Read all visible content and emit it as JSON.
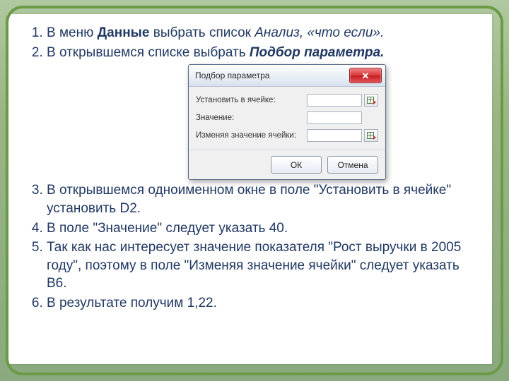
{
  "steps": {
    "s1_a": "В меню ",
    "s1_b": "Данные",
    "s1_c": " выбрать список ",
    "s1_d": "Анализ, «что если».",
    "s2_a": "В открывшемся списке выбрать ",
    "s2_b": "Подбор параметра.",
    "s3": "В открывшемся одноименном окне в поле \"Установить в ячейке\" установить D2.",
    "s4": "В поле \"Значение\" следует указать 40.",
    "s5": "Так как нас интересует значение показателя \"Рост выручки в 2005 году\", поэтому в поле \"Изменяя значение ячейки\" следует указать  B6.",
    "s6": "В результате получим 1,22."
  },
  "dialog": {
    "title": "Подбор параметра",
    "rows": {
      "set_cell": "Установить в ячейке:",
      "value": "Значение:",
      "change_cell": "Изменяя значение ячейки:"
    },
    "buttons": {
      "ok": "ОК",
      "cancel": "Отмена"
    },
    "close_glyph": "✕"
  }
}
